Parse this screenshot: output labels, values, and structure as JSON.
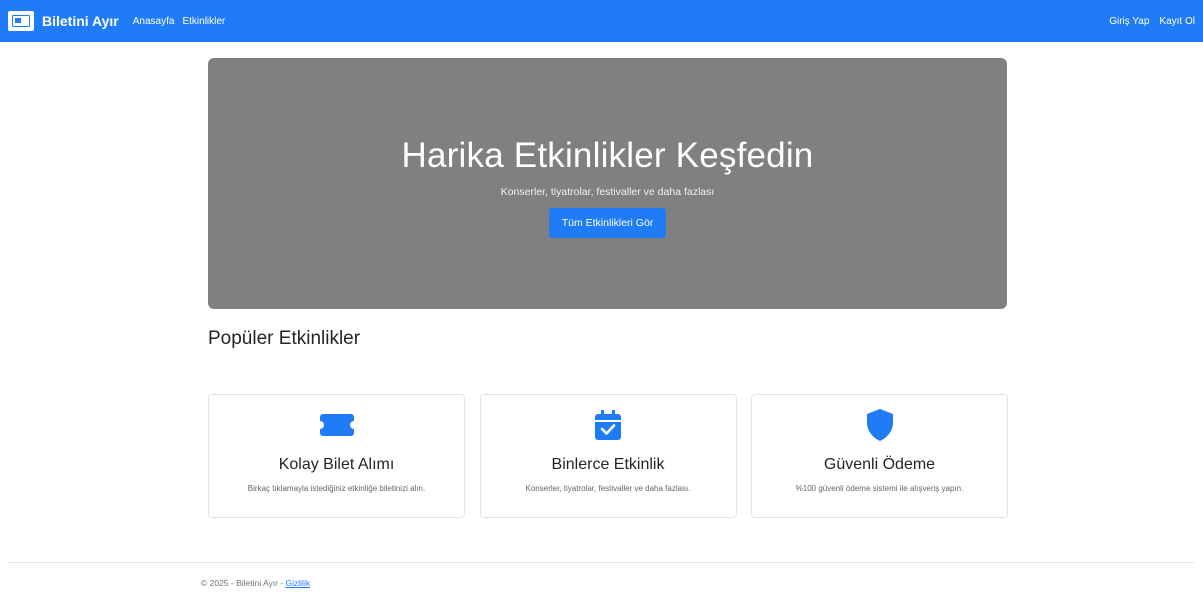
{
  "navbar": {
    "brand": "Biletini Ayır",
    "links": [
      "Anasayfa",
      "Etkinlikler"
    ],
    "right_links": [
      "Giriş Yap",
      "Kayıt Ol"
    ]
  },
  "hero": {
    "title": "Harika Etkinlikler Keşfedin",
    "subtitle": "Konserler, tiyatrolar, festivaller ve daha fazlası",
    "button": "Tüm Etkinlikleri Gör"
  },
  "section": {
    "title": "Popüler Etkinlikler"
  },
  "cards": [
    {
      "icon": "ticket-icon",
      "title": "Kolay Bilet Alımı",
      "text": "Birkaç tıklamayla istediğiniz etkinliğe biletinizi alın."
    },
    {
      "icon": "calendar-check-icon",
      "title": "Binlerce Etkinlik",
      "text": "Konserler, tiyatrolar, festivaller ve daha fazlası."
    },
    {
      "icon": "shield-icon",
      "title": "Güvenli Ödeme",
      "text": "%100 güvenli ödeme sistemi ile alışveriş yapın."
    }
  ],
  "footer": {
    "text": "© 2025 - Biletini Ayır - ",
    "link": "Gizlilik"
  },
  "colors": {
    "primary": "#1f7cf6",
    "hero_bg": "#808080"
  }
}
